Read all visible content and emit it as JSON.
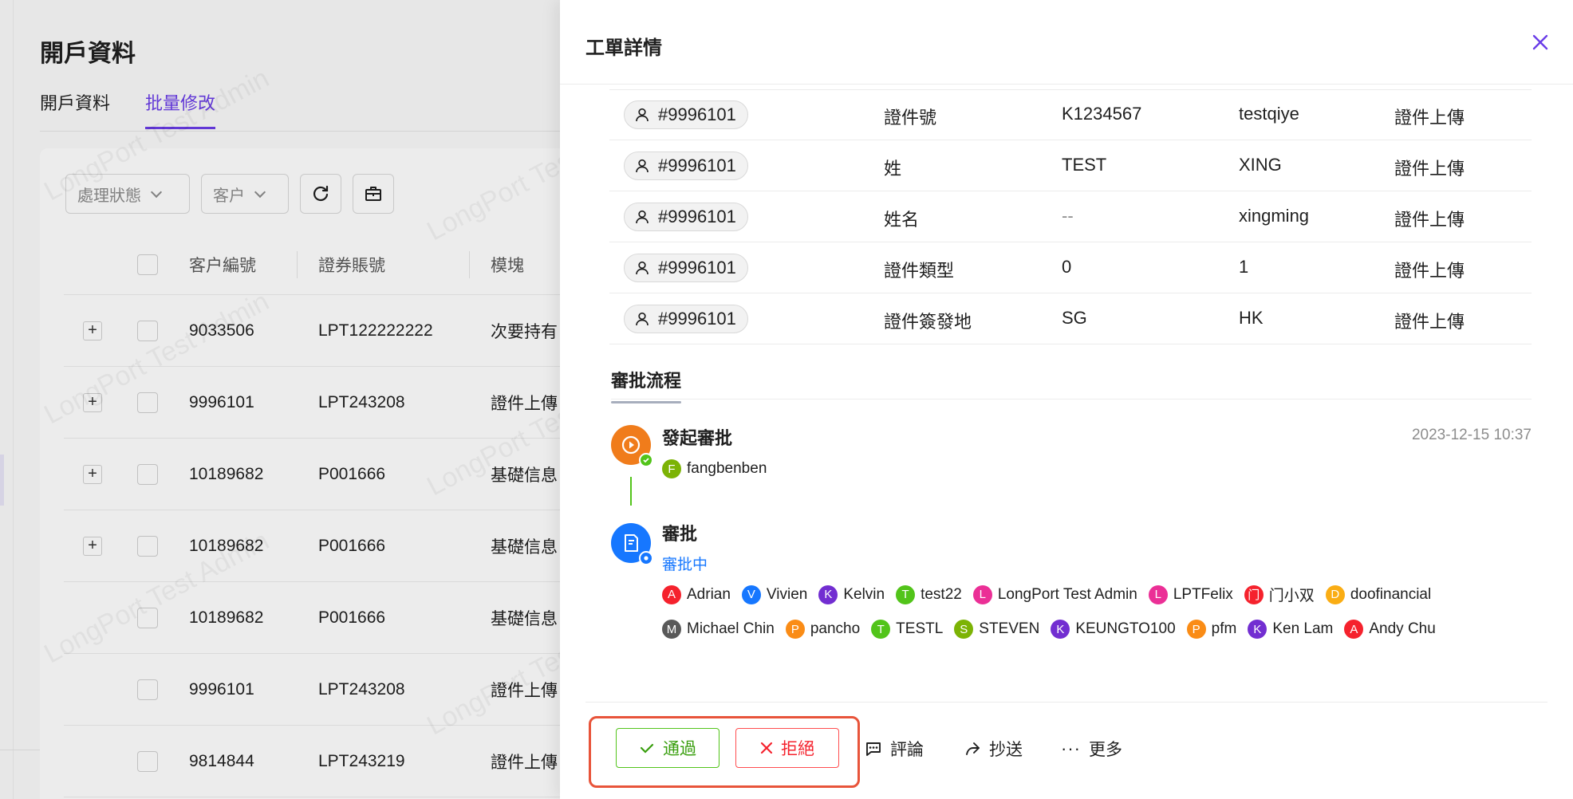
{
  "background": {
    "page_title": "開戶資料",
    "tabs": [
      {
        "label": "開戶資料",
        "active": false
      },
      {
        "label": "批量修改",
        "active": true
      }
    ],
    "filters": [
      {
        "label": "處理狀態"
      },
      {
        "label": "客户"
      }
    ],
    "table": {
      "headers": [
        "客户編號",
        "證券賬號",
        "模塊"
      ],
      "rows": [
        {
          "expand": "+",
          "customer_no": "9033506",
          "account": "LPT122222222",
          "module": "次要持有"
        },
        {
          "expand": "+",
          "customer_no": "9996101",
          "account": "LPT243208",
          "module": "證件上傳"
        },
        {
          "expand": "+",
          "customer_no": "10189682",
          "account": "P001666",
          "module": "基礎信息"
        },
        {
          "expand": "+",
          "customer_no": "10189682",
          "account": "P001666",
          "module": "基礎信息"
        },
        {
          "expand": "",
          "customer_no": "10189682",
          "account": "P001666",
          "module": "基礎信息"
        },
        {
          "expand": "",
          "customer_no": "9996101",
          "account": "LPT243208",
          "module": "證件上傳"
        },
        {
          "expand": "",
          "customer_no": "9814844",
          "account": "LPT243219",
          "module": "證件上傳"
        }
      ]
    },
    "watermark_text": "LongPort Test Admin"
  },
  "drawer": {
    "title": "工單詳情",
    "records": [
      {
        "user": "#9996101",
        "field": "證件號",
        "old": "K1234567",
        "new": "testqiye",
        "module": "證件上傳"
      },
      {
        "user": "#9996101",
        "field": "姓",
        "old": "TEST",
        "new": "XING",
        "module": "證件上傳"
      },
      {
        "user": "#9996101",
        "field": "姓名",
        "old": "--",
        "new": "xingming",
        "module": "證件上傳"
      },
      {
        "user": "#9996101",
        "field": "證件類型",
        "old": "0",
        "new": "1",
        "module": "證件上傳"
      },
      {
        "user": "#9996101",
        "field": "證件簽發地",
        "old": "SG",
        "new": "HK",
        "module": "證件上傳"
      }
    ],
    "flow": {
      "title": "審批流程",
      "nodes": [
        {
          "title": "發起審批",
          "time": "2023-12-15 10:37",
          "people": [
            {
              "initial": "F",
              "name": "fangbenben",
              "color": "#7cb305"
            }
          ]
        },
        {
          "title": "審批",
          "status": "審批中",
          "people_row1": [
            {
              "initial": "A",
              "name": "Adrian",
              "color": "#f5222d"
            },
            {
              "initial": "V",
              "name": "Vivien",
              "color": "#1677ff"
            },
            {
              "initial": "K",
              "name": "Kelvin",
              "color": "#722ed1"
            },
            {
              "initial": "T",
              "name": "test22",
              "color": "#52c41a"
            },
            {
              "initial": "L",
              "name": "LongPort Test Admin",
              "color": "#eb2f96"
            },
            {
              "initial": "L",
              "name": "LPTFelix",
              "color": "#eb2f96"
            },
            {
              "initial": "门",
              "name": "门小双",
              "color": "#f5222d"
            },
            {
              "initial": "D",
              "name": "doofinancial",
              "color": "#faad14"
            }
          ],
          "people_row2": [
            {
              "initial": "M",
              "name": "Michael Chin",
              "color": "#595959"
            },
            {
              "initial": "P",
              "name": "pancho",
              "color": "#fa8c16"
            },
            {
              "initial": "T",
              "name": "TESTL",
              "color": "#52c41a"
            },
            {
              "initial": "S",
              "name": "STEVEN",
              "color": "#7cb305"
            },
            {
              "initial": "K",
              "name": "KEUNGTO100",
              "color": "#722ed1"
            },
            {
              "initial": "P",
              "name": "pfm",
              "color": "#fa8c16"
            },
            {
              "initial": "K",
              "name": "Ken Lam",
              "color": "#722ed1"
            },
            {
              "initial": "A",
              "name": "Andy Chu",
              "color": "#f5222d"
            }
          ]
        }
      ]
    },
    "footer": {
      "approve_label": "通過",
      "reject_label": "拒絕",
      "comment_label": "評論",
      "cc_label": "抄送",
      "more_label": "更多"
    }
  },
  "colors": {
    "accent": "#6a3de8",
    "approve": "#52c41a",
    "reject": "#ff4d4f",
    "highlight_box": "#e8543a",
    "in_progress": "#1677ff"
  }
}
